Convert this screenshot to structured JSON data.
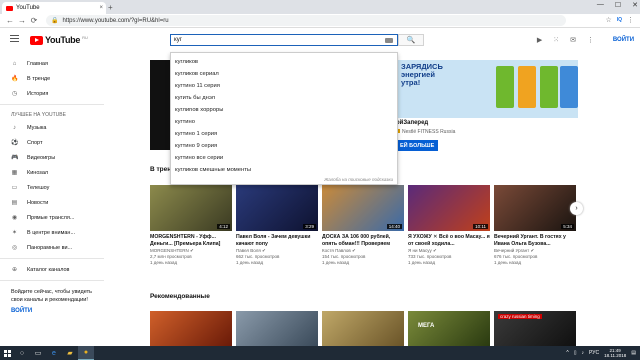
{
  "browser": {
    "tab_title": "YouTube",
    "tab_close": "×",
    "new_tab": "+",
    "window_controls": [
      "—",
      "☐",
      "✕"
    ],
    "url": "https://www.youtube.com/?gl=RU&hl=ru",
    "nav_back": "←",
    "nav_forward": "→",
    "nav_reload": "⟳",
    "ext_label": "IQ"
  },
  "header": {
    "logo_text": "YouTube",
    "logo_region": "RU",
    "search_value": "куг",
    "signin_label": "ВОЙТИ"
  },
  "suggestions": [
    "кугликов",
    "кугликов сериал",
    "кугтино 11 серия",
    "кугить бы днэл",
    "куглиnов хорроры",
    "кугтино",
    "кугтино 1 серия",
    "кугтино 9 серия",
    "кугтино все серии",
    "кугликов смешные моменты"
  ],
  "suggestion_report": "Жалоба на поисковые подсказки",
  "sidebar": {
    "main_items": [
      {
        "label": "Главная",
        "icon": "home-icon",
        "glyph": "⌂"
      },
      {
        "label": "В тренде",
        "icon": "fire-icon",
        "glyph": "🔥"
      },
      {
        "label": "История",
        "icon": "history-icon",
        "glyph": "◷"
      }
    ],
    "section_title": "ЛУЧШЕЕ НА YOUTUBE",
    "best_items": [
      {
        "label": "Музыка",
        "icon": "music-icon",
        "glyph": "♪"
      },
      {
        "label": "Спорт",
        "icon": "sport-icon",
        "glyph": "⚽"
      },
      {
        "label": "Видеоигры",
        "icon": "gamepad-icon",
        "glyph": "🎮"
      },
      {
        "label": "Кинозал",
        "icon": "film-icon",
        "glyph": "▦"
      },
      {
        "label": "Телешоу",
        "icon": "tv-icon",
        "glyph": "▭"
      },
      {
        "label": "Новости",
        "icon": "news-icon",
        "glyph": "▤"
      },
      {
        "label": "Прямые трансля...",
        "icon": "live-icon",
        "glyph": "◉"
      },
      {
        "label": "В центре вниман...",
        "icon": "spotlight-icon",
        "glyph": "✶"
      },
      {
        "label": "Панорамные ви...",
        "icon": "panorama-icon",
        "glyph": "◎"
      }
    ],
    "catalog": {
      "label": "Каталог каналов",
      "icon": "plus-circle-icon",
      "glyph": "⊕"
    },
    "signin_hint": "Войдите сейчас, чтобы увидеть свои каналы и рекомендации!",
    "signin_button": "ВОЙТИ"
  },
  "ad": {
    "headline_1": "ЗАРЯДИСЬ",
    "headline_2": "энергией",
    "headline_3": "утра!",
    "name": "ойЗаперед",
    "advertiser": "Nestlé FITNESS Russia",
    "cta": "ЕЙ БОЛЬШЕ"
  },
  "trending": {
    "title": "В трен",
    "videos": [
      {
        "title": "MORGENSHTERN - Уфф... Деньги... [Премьера Клипа]",
        "channel": "MORGENSHTERN ✔",
        "views": "2,7 млн просмотров",
        "age": "1 день назад",
        "duration": "4:12",
        "bg": "#6b6a3c"
      },
      {
        "title": "Павел Воля - Зачем девушки качают попу",
        "channel": "Павел Воля ✔",
        "views": "662 тыс. просмотров",
        "age": "1 день назад",
        "duration": "3:29",
        "bg": "#2a2f5a"
      },
      {
        "title": "ДОСКА ЗА 106 000 рублей, опять обман!!! Проверяем",
        "channel": "Костя Павлов ✔",
        "views": "154 тыс. просмотров",
        "age": "1 день назад",
        "duration": "14:40",
        "bg": "#8a5a2c"
      },
      {
        "title": "Я УХОЖУ ✕ Всё о воо Масау... я от своей ходила...",
        "channel": "Я ни Масуу ✔",
        "views": "733 тыс. просмотров",
        "age": "1 день назад",
        "duration": "10:11",
        "bg": "#3a1f4a"
      },
      {
        "title": "Вечерний Ургант. В гостях у Ивана Ольга Бузова...",
        "channel": "Вечерний Ургант ✔",
        "views": "676 тыс. просмотров",
        "age": "1 день назад",
        "duration": "5:34",
        "bg": "#4a3028"
      }
    ]
  },
  "recommended": {
    "title": "Рекомендованные",
    "thumbs": [
      {
        "bg": "#b0431c",
        "label": ""
      },
      {
        "bg": "#6a7a8a",
        "label": ""
      },
      {
        "bg": "#a08a50",
        "label": ""
      },
      {
        "bg": "#5a6b2a",
        "label": "МЕГА"
      },
      {
        "bg": "#2e2e2e",
        "label": "crazy russian timing"
      }
    ]
  },
  "taskbar": {
    "lang": "РУС",
    "time": "21:49",
    "date": "18.11.2018"
  },
  "colors": {
    "brand_red": "#ff0000",
    "link_blue": "#065fd4"
  }
}
